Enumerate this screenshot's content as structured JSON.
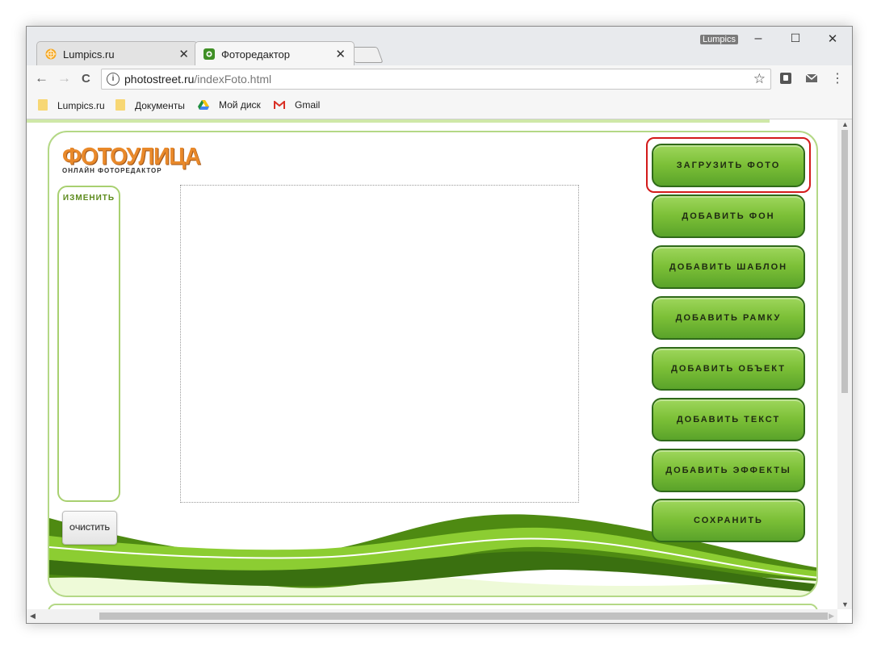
{
  "window": {
    "title_user": "Lumpics",
    "min_label": "–",
    "max_label": "☐",
    "close_label": "✕"
  },
  "tabs": [
    {
      "label": "Lumpics.ru",
      "close": "✕",
      "favicon": "orange-icon"
    },
    {
      "label": "Фоторедактор",
      "close": "✕",
      "favicon": "photostreet-icon"
    }
  ],
  "toolbar": {
    "back": "←",
    "forward": "→",
    "reload": "C",
    "url_host": "photostreet.ru",
    "url_path": "/indexFoto.html",
    "star": "☆",
    "menu": "⋮"
  },
  "bookmarks": [
    {
      "label": "Lumpics.ru",
      "icon": "folder-icon"
    },
    {
      "label": "Документы",
      "icon": "folder-icon"
    },
    {
      "label": "Мой диск",
      "icon": "google-drive-icon"
    },
    {
      "label": "Gmail",
      "icon": "gmail-icon"
    }
  ],
  "site": {
    "logo_title": "ФОТОУЛИЦА",
    "logo_subtitle": "ОНЛАЙН ФОТОРЕДАКТОР",
    "side_panel_title": "ИЗМЕНИТЬ",
    "clear_button": "ОЧИСТИТЬ",
    "buttons": [
      "ЗАГРУЗИТЬ ФОТО",
      "ДОБАВИТЬ ФОН",
      "ДОБАВИТЬ ШАБЛОН",
      "ДОБАВИТЬ РАМКУ",
      "ДОБАВИТЬ ОБЪЕКТ",
      "ДОБАВИТЬ ТЕКСТ",
      "ДОБАВИТЬ ЭФФЕКТЫ",
      "СОХРАНИТЬ"
    ],
    "highlighted_button": "ЗАГРУЗИТЬ ФОТО"
  },
  "colors": {
    "button_green": "#7cc037",
    "button_border": "#2f6a19",
    "highlight_red": "#d31a1a",
    "logo_orange": "#e9892a",
    "frame_green": "#b4d886"
  }
}
